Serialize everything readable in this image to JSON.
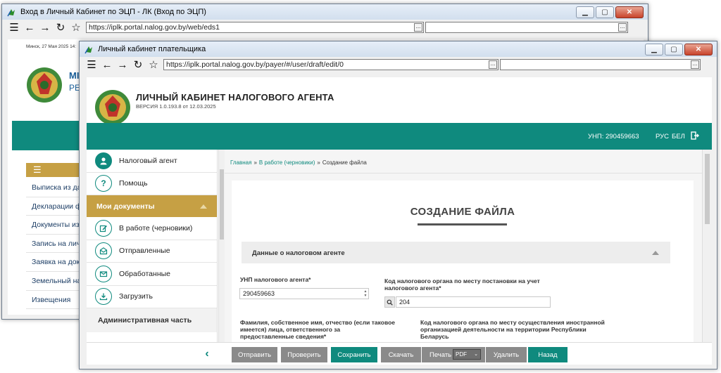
{
  "back_window": {
    "title": "Вход в Личный Кабинет по ЭЦП - ЛК (Вход по ЭЦП)",
    "url": "https://iplk.portal.nalog.gov.by/web/eds1",
    "date_text": "Минск, 27 Мая 2025 14:",
    "brand_line1": "МІ",
    "brand_line2": "РЕ",
    "menu_icon": "☰",
    "menu_items": [
      "Выписка из да",
      "Декларации ф",
      "Документы из",
      "Запись на личн",
      "Заявка на доку",
      "Земельный на",
      "Извещения"
    ]
  },
  "front_window": {
    "title": "Личный кабинет плательщика",
    "url": "https://iplk.portal.nalog.gov.by/payer/#/user/draft/edit/0"
  },
  "header": {
    "title": "ЛИЧНЫЙ КАБИНЕТ НАЛОГОВОГО АГЕНТА",
    "version": "ВЕРСИЯ 1.0.193.8 от 12.03.2025",
    "unp": "УНП: 290459663",
    "lang_rus": "РУС",
    "lang_bel": "БЕЛ"
  },
  "sidebar": {
    "items_top": [
      "Налоговый агент",
      "Помощь"
    ],
    "active_section": "Мои документы",
    "doc_items": [
      "В работе (черновики)",
      "Отправленные",
      "Обработанные",
      "Загрузить"
    ],
    "admin_section": "Административная часть"
  },
  "breadcrumb": {
    "home": "Главная",
    "drafts": "В работе (черновики)",
    "current": "Создание файла",
    "separator": "»"
  },
  "form": {
    "page_title": "СОЗДАНИЕ ФАЙЛА",
    "section_title": "Данные о налоговом агенте",
    "unp_label": "УНП налогового агента*",
    "unp_value": "290459663",
    "tax_office_label_line1": "Код налогового органа по месту постановки на учет",
    "tax_office_label_line2": "налогового агента*",
    "tax_office_value": "204",
    "fio_label_line1": "Фамилия, собственное имя, отчество (если таковое",
    "fio_label_line2": "имеется) лица, ответственного за",
    "fio_label_line3": "предоставленные сведения*",
    "foreign_label_line1": "Код налогового органа по месту осуществления иностранной",
    "foreign_label_line2": "организацией деятельности на территории Республики",
    "foreign_label_line3": "Беларусь"
  },
  "actions": {
    "send": "Отправить",
    "check": "Проверить",
    "save": "Сохранить",
    "download": "Скачать",
    "print": "Печать",
    "print_format": "PDF",
    "delete": "Удалить",
    "back": "Назад"
  },
  "colors": {
    "teal": "#0f8a7e",
    "gold": "#c6a044",
    "gray_button": "#8a8a8a"
  }
}
